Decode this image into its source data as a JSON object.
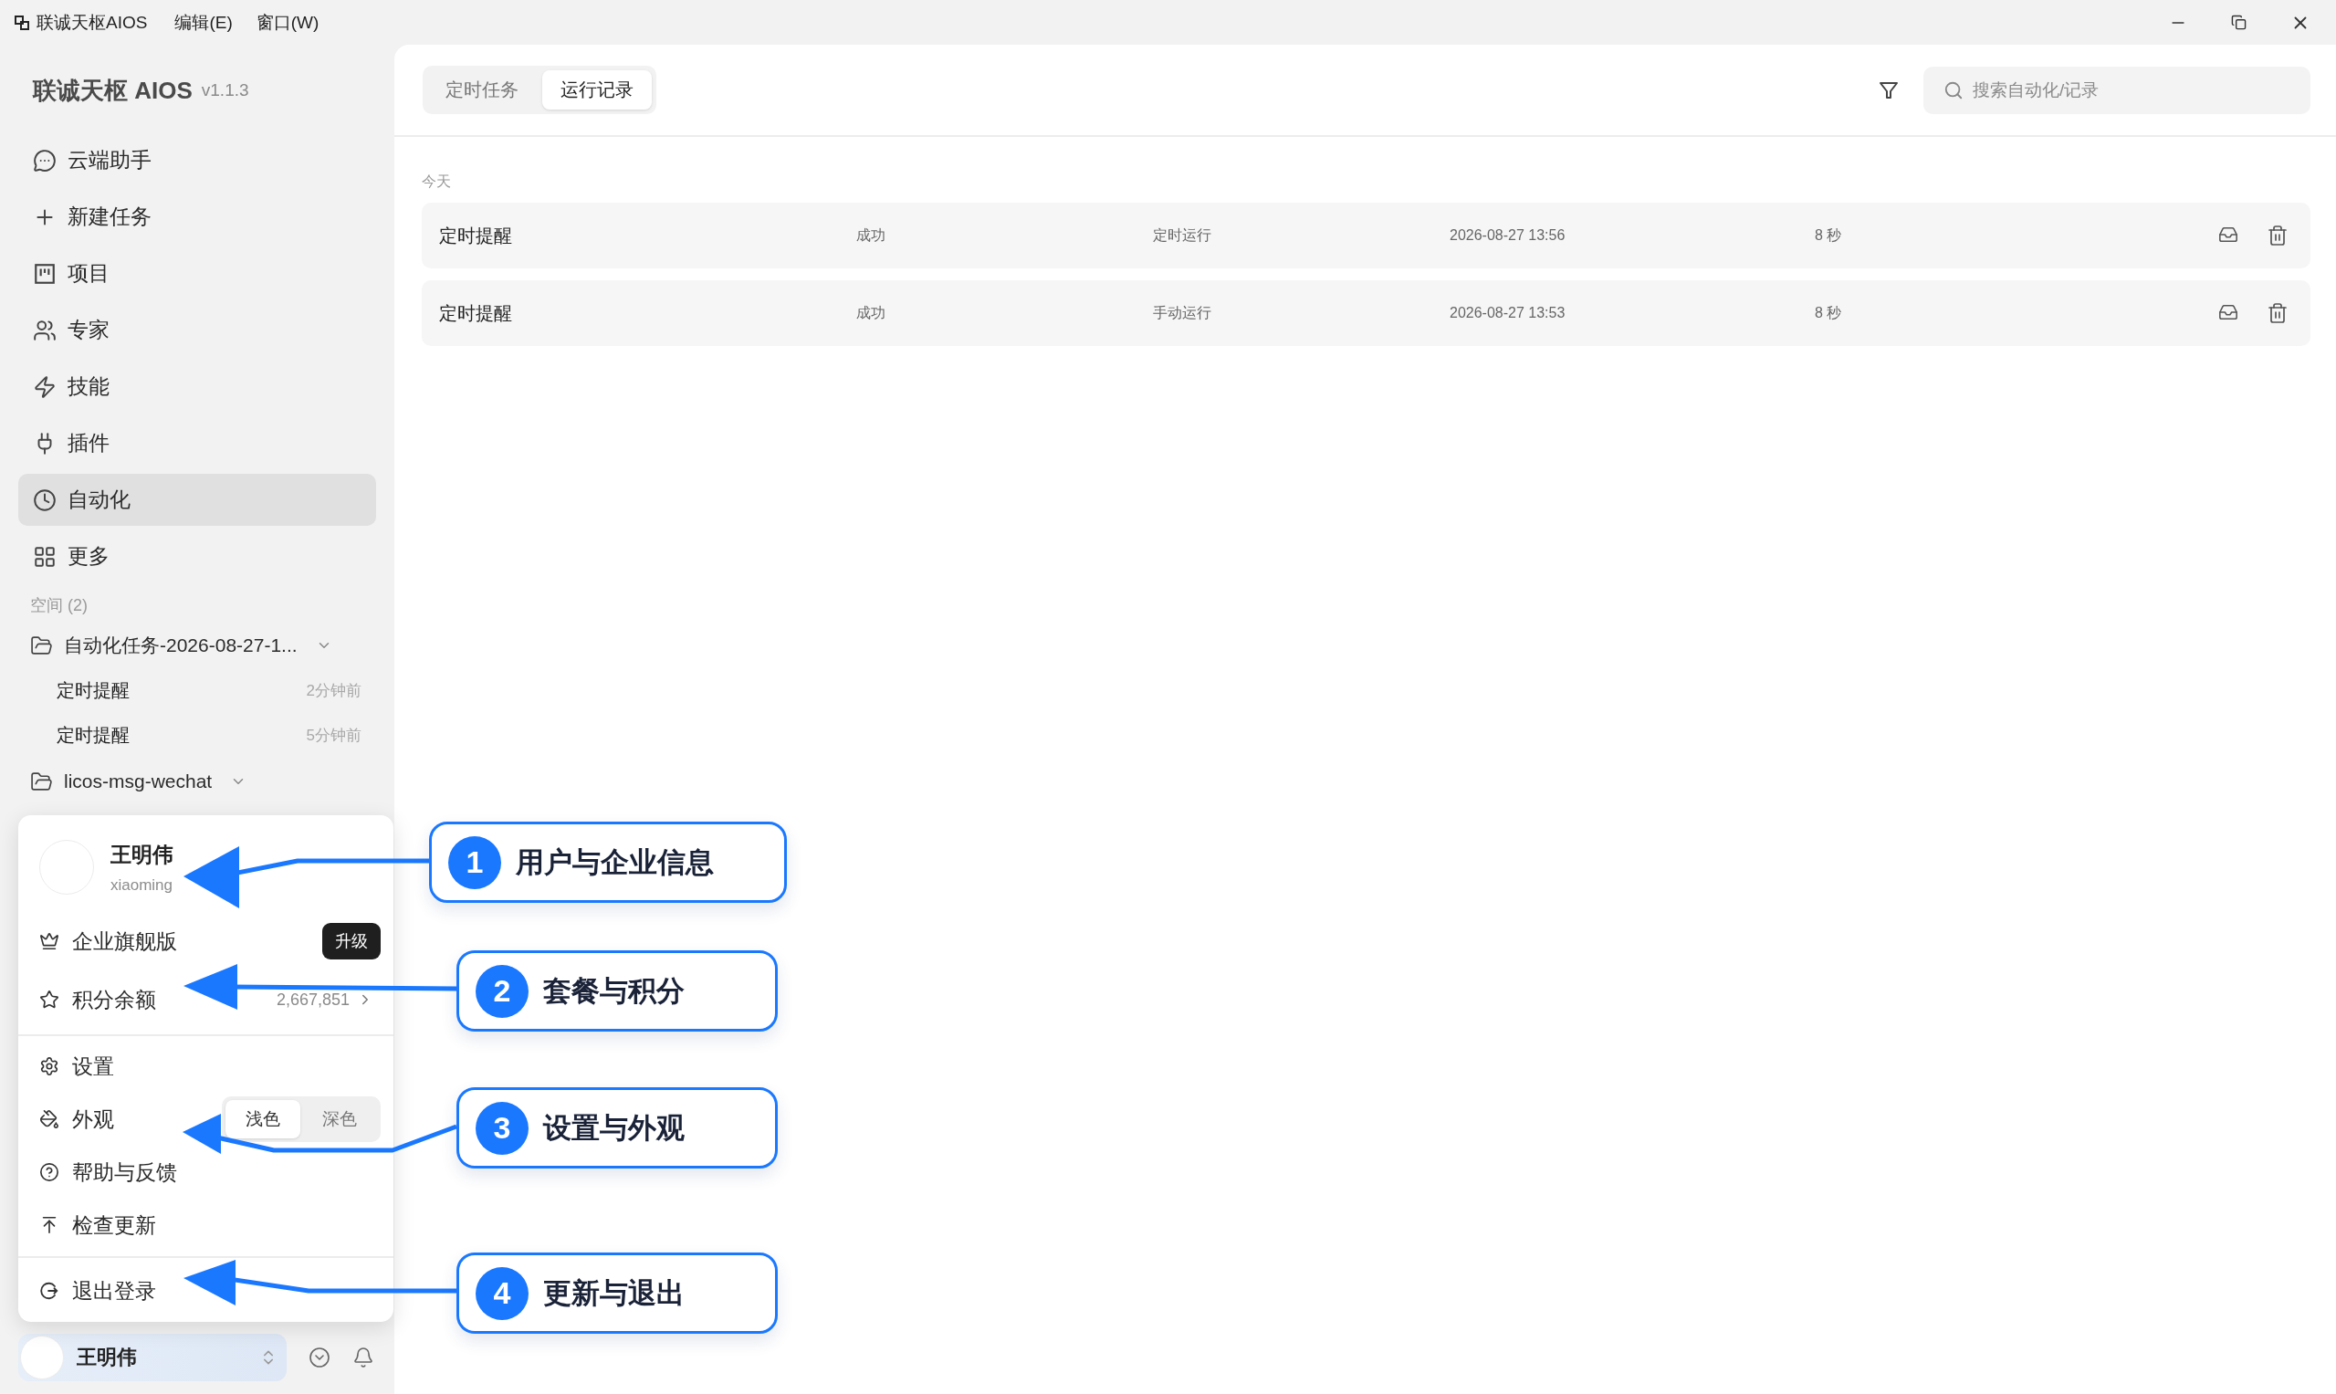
{
  "title_bar": {
    "app_name": "联诚天枢AIOS",
    "menus": [
      {
        "label": "编辑(E)"
      },
      {
        "label": "窗口(W)"
      }
    ]
  },
  "sidebar": {
    "brand": "联诚天枢 AIOS",
    "version": "v1.1.3",
    "nav": [
      {
        "label": "云端助手",
        "selected": false
      },
      {
        "label": "新建任务",
        "selected": false
      },
      {
        "label": "项目",
        "selected": false
      },
      {
        "label": "专家",
        "selected": false
      },
      {
        "label": "技能",
        "selected": false
      },
      {
        "label": "插件",
        "selected": false
      },
      {
        "label": "自动化",
        "selected": true
      },
      {
        "label": "更多",
        "selected": false
      }
    ],
    "spaces_heading": "空间 (2)",
    "spaces": [
      {
        "name": "自动化任务-2026-08-27-1...",
        "children": [
          {
            "name": "定时提醒",
            "time": "2分钟前"
          },
          {
            "name": "定时提醒",
            "time": "5分钟前"
          }
        ]
      },
      {
        "name": "licos-msg-wechat"
      }
    ],
    "user": {
      "name": "王明伟"
    }
  },
  "user_menu": {
    "name": "王明伟",
    "username": "xiaoming",
    "sections": [
      [
        {
          "kind": "plan",
          "label": "企业旗舰版",
          "badge": "升级"
        },
        {
          "kind": "points",
          "label": "积分余额",
          "value": "2,667,851"
        }
      ],
      [
        {
          "kind": "link",
          "label": "设置"
        },
        {
          "kind": "theme",
          "label": "外观",
          "options": [
            {
              "label": "浅色",
              "selected": true
            },
            {
              "label": "深色",
              "selected": false
            }
          ]
        },
        {
          "kind": "link",
          "label": "帮助与反馈"
        },
        {
          "kind": "link",
          "label": "检查更新"
        }
      ],
      [
        {
          "kind": "link",
          "label": "退出登录"
        }
      ]
    ]
  },
  "tabs": [
    {
      "label": "定时任务",
      "selected": false
    },
    {
      "label": "运行记录",
      "selected": true
    }
  ],
  "search": {
    "placeholder": "搜索自动化/记录"
  },
  "records": {
    "group": "今天",
    "rows": [
      {
        "name": "定时提醒",
        "status": "成功",
        "trigger": "定时运行",
        "time": "2026-08-27 13:56",
        "duration": "8 秒"
      },
      {
        "name": "定时提醒",
        "status": "成功",
        "trigger": "手动运行",
        "time": "2026-08-27 13:53",
        "duration": "8 秒"
      }
    ]
  },
  "callouts": [
    {
      "number": "1",
      "label": "用户与企业信息"
    },
    {
      "number": "2",
      "label": "套餐与积分"
    },
    {
      "number": "3",
      "label": "设置与外观"
    },
    {
      "number": "4",
      "label": "更新与退出"
    }
  ]
}
